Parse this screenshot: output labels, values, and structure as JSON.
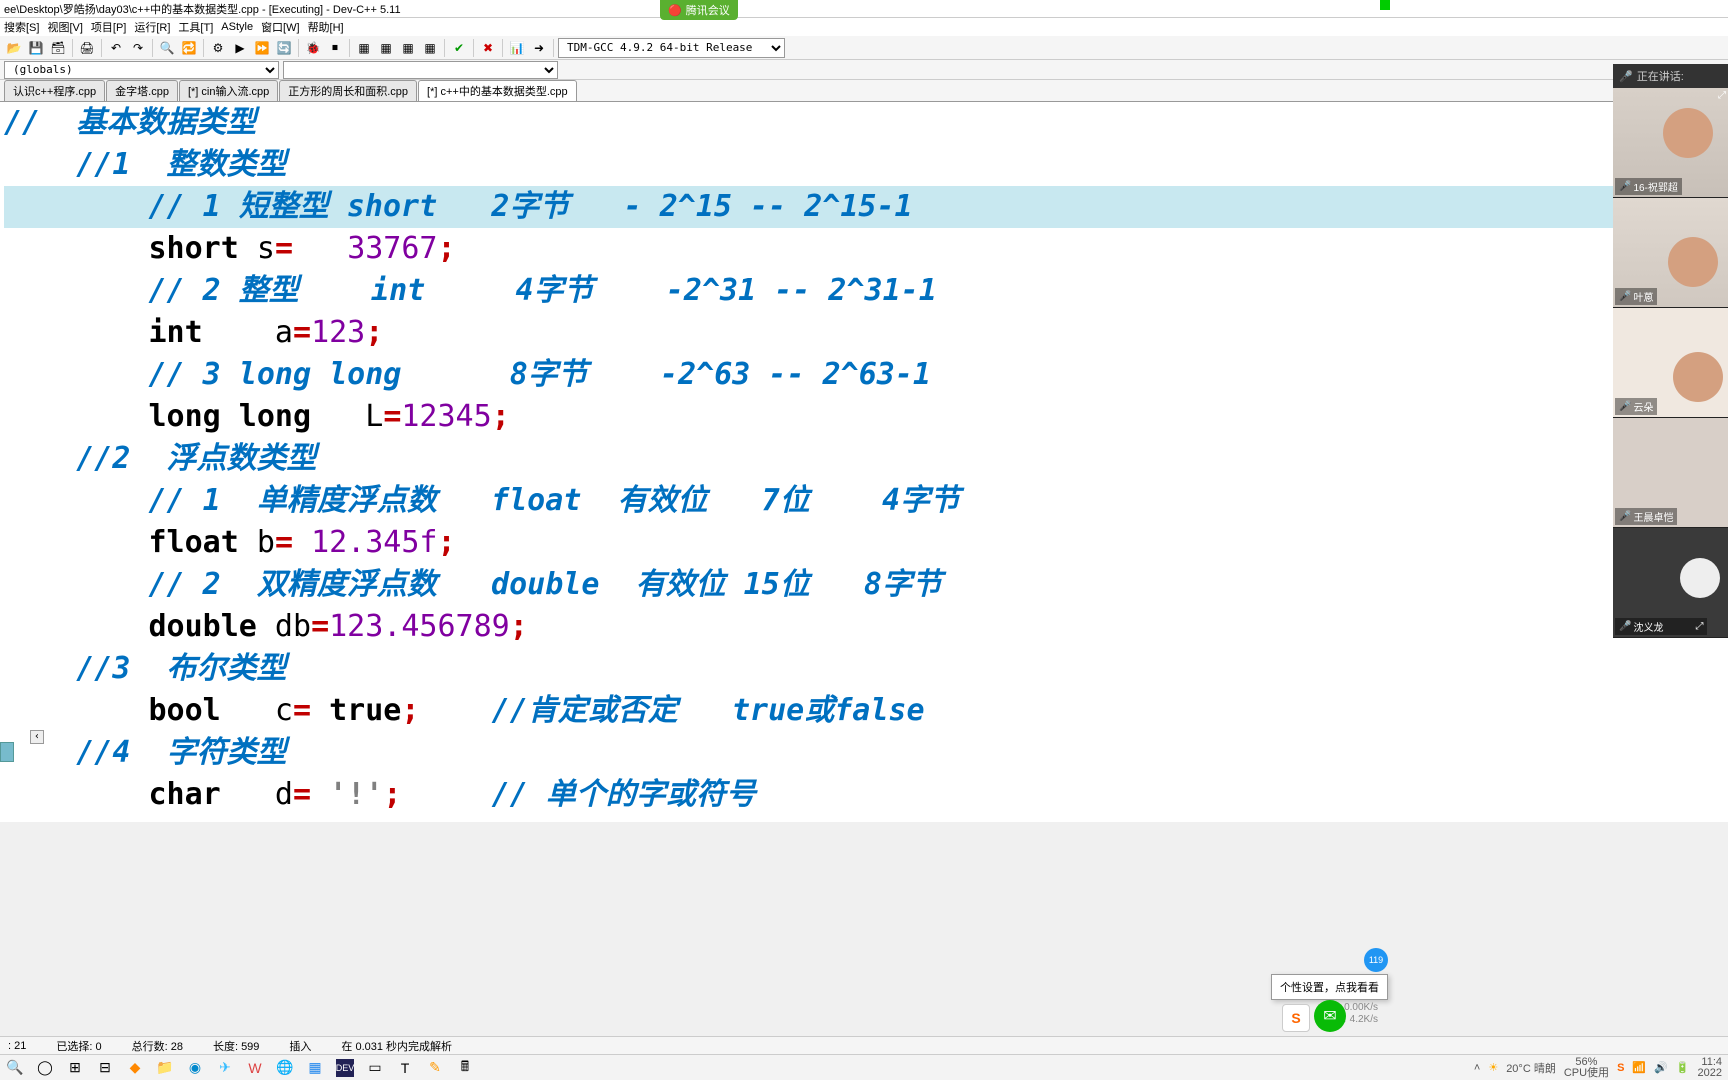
{
  "titlebar": "ee\\Desktop\\罗皓扬\\day03\\c++中的基本数据类型.cpp - [Executing] - Dev-C++ 5.11",
  "menu": {
    "search": "搜索[S]",
    "view": "视图[V]",
    "project": "项目[P]",
    "run": "运行[R]",
    "tools": "工具[T]",
    "astyle": "AStyle",
    "window": "窗口[W]",
    "help": "帮助[H]"
  },
  "compiler": "TDM-GCC 4.9.2 64-bit Release",
  "globals": "(globals)",
  "tabs": [
    "认识c++程序.cpp",
    "金字塔.cpp",
    "[*] cin输入流.cpp",
    "正方形的周长和面积.cpp",
    "[*] c++中的基本数据类型.cpp"
  ],
  "code": {
    "c1": "//  基本数据类型",
    "c2": "    //1  整数类型",
    "c3": "        // 1 短整型 ",
    "c3b": "short   2字节   - 2^15 -- 2^15-1",
    "l4a": "        ",
    "l4kw": "short",
    "l4b": " s",
    "l4op": "=",
    "l4c": "   ",
    "l4n": "33767",
    "l4s": ";",
    "c5": "        // 2 整型    int     4字节    -2^31 -- 2^31-1",
    "l6a": "        ",
    "l6kw": "int",
    "l6b": "    a",
    "l6op": "=",
    "l6n": "123",
    "l6s": ";",
    "c7": "        // 3 long long      8字节    -2^63 -- 2^63-1",
    "l8a": "        ",
    "l8kw": "long long",
    "l8b": "   L",
    "l8op": "=",
    "l8n": "12345",
    "l8s": ";",
    "c9": "    //2  浮点数类型",
    "c10": "        // 1  单精度浮点数   float  有效位   7位    4字节",
    "l11a": "        ",
    "l11kw": "float",
    "l11b": " b",
    "l11op": "=",
    "l11c": " ",
    "l11n": "12.345f",
    "l11s": ";",
    "c12": "        // 2  双精度浮点数   double  有效位 15位   8字节",
    "l13a": "        ",
    "l13kw": "double",
    "l13b": " db",
    "l13op": "=",
    "l13n": "123.456789",
    "l13s": ";",
    "c14": "    //3  布尔类型",
    "l15a": "        ",
    "l15kw": "bool",
    "l15b": "   c",
    "l15op": "=",
    "l15c": " ",
    "l15kw2": "true",
    "l15s": ";",
    "l15cm": "    //肯定或否定   true或false",
    "c16": "    //4  字符类型",
    "l17a": "        ",
    "l17kw": "char",
    "l17b": "   d",
    "l17op": "=",
    "l17c": " ",
    "l17str": "'!'",
    "l17s": ";",
    "l17cm": "     // 单个的字或符号"
  },
  "status": {
    "line": ": 21",
    "sel": "已选择:  0",
    "total": "总行数:  28",
    "len": "长度:  599",
    "mode": "插入",
    "parse": "在 0.031 秒内完成解析"
  },
  "meeting": {
    "badge": "腾讯会议",
    "speaking": "正在讲话:",
    "p1": "16-祝郢超",
    "p2": "叶蒽",
    "p3": "云朵",
    "p4": "王晨卓恺",
    "p5": "沈义龙"
  },
  "popup": "个性设置，点我看看",
  "float_badge": "119",
  "tray": {
    "weather": "20°C 晴朗",
    "cpu_pct": "56%",
    "cpu_lbl": "CPU使用",
    "time": "11:4",
    "date": "2022"
  },
  "netstat": {
    "up": "0.00K/s",
    "down": "4.2K/s"
  }
}
